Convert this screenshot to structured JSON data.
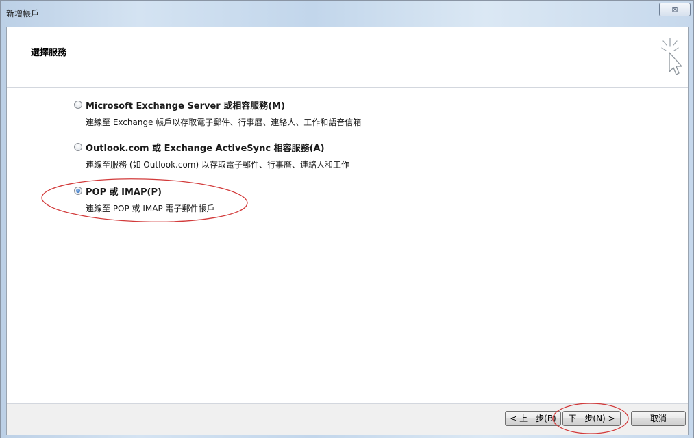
{
  "window": {
    "title": "新增帳戶",
    "close_icon": "close-icon",
    "close_glyph": "⊠"
  },
  "header": {
    "title": "選擇服務",
    "icon": "wizard-cursor-icon"
  },
  "options": [
    {
      "label": "Microsoft Exchange Server 或相容服務(M)",
      "description": "連線至 Exchange 帳戶以存取電子郵件、行事曆、連絡人、工作和語音信箱",
      "selected": false
    },
    {
      "label": "Outlook.com 或 Exchange ActiveSync 相容服務(A)",
      "description": "連線至服務 (如 Outlook.com) 以存取電子郵件、行事曆、連絡人和工作",
      "selected": false
    },
    {
      "label": "POP 或 IMAP(P)",
      "description": "連線至 POP 或 IMAP 電子郵件帳戶",
      "selected": true
    }
  ],
  "buttons": {
    "back": "< 上一步(B)",
    "next": "下一步(N) >",
    "cancel": "取消"
  },
  "colors": {
    "annotation": "#d23a3a",
    "radio_checked": "#1c5fb4"
  }
}
